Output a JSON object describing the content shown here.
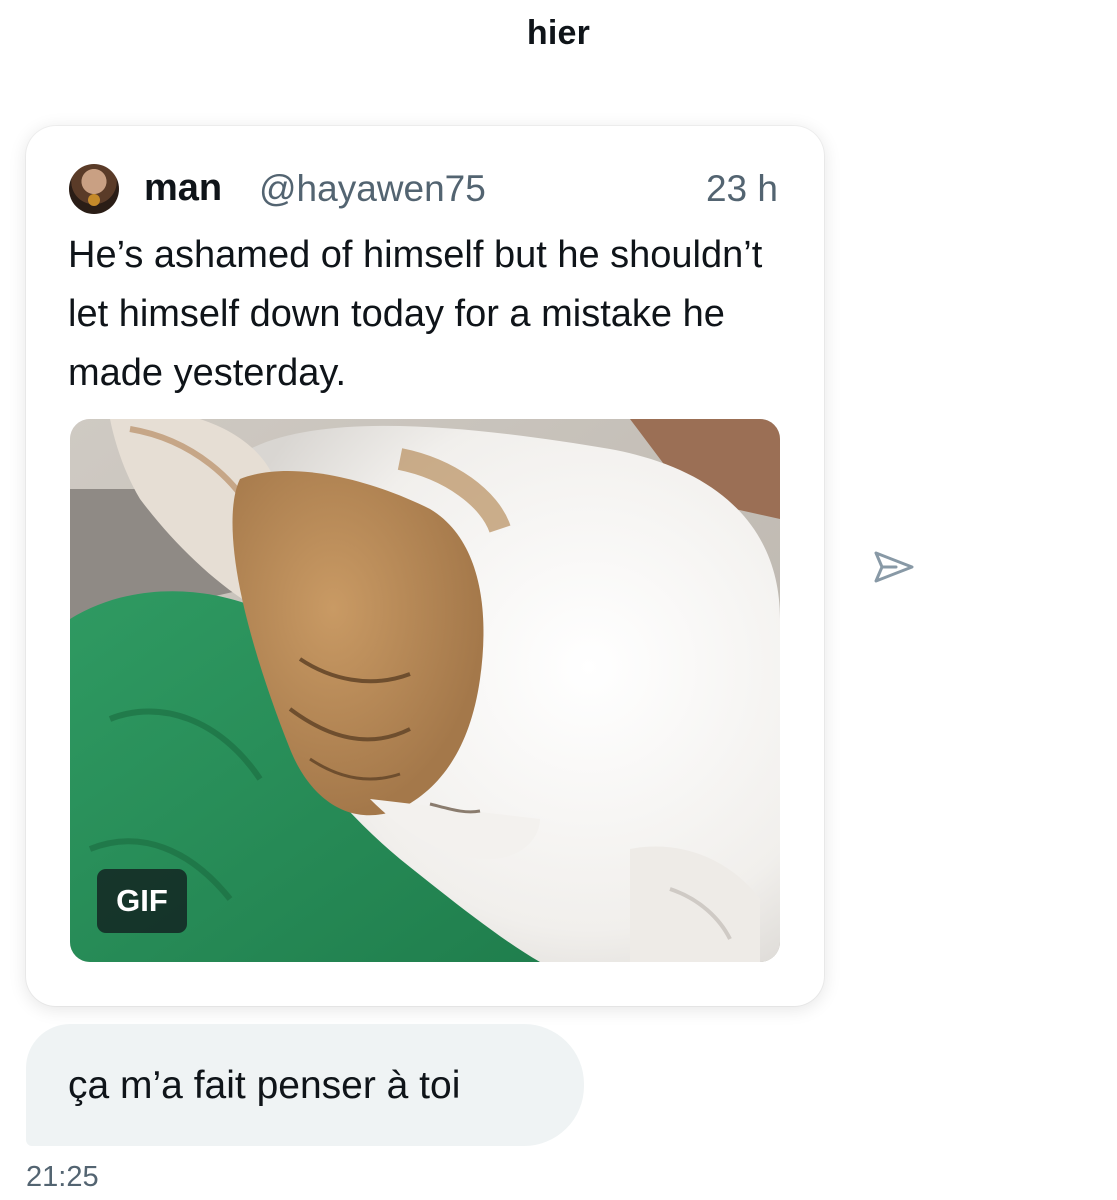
{
  "conversation": {
    "day_separator": "hier"
  },
  "shared_post": {
    "author_name": "man",
    "author_handle": "@hayawen75",
    "timestamp": "23 h",
    "text": "He’s ashamed of himself but he shouldn’t let himself down today for a mistake he made yesterday.",
    "media_type_badge": "GIF",
    "media_description_icon": "sleeping-cat-gif"
  },
  "message": {
    "text": "ça m’a fait penser à toi",
    "sent_time": "21:25"
  },
  "icons": {
    "share": "share-arrow-icon",
    "avatar": "author-avatar"
  },
  "colors": {
    "text_primary": "#0f1419",
    "text_secondary": "#536471",
    "bubble_background": "#eff3f4",
    "icon_gray": "#8899a6"
  }
}
